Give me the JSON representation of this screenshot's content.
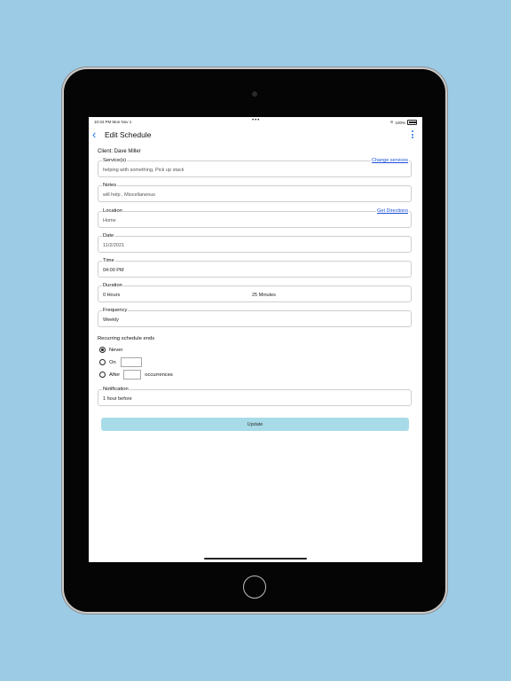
{
  "status_bar": {
    "time": "10:34 PM   Mon Nov 1",
    "battery": "100%"
  },
  "nav": {
    "back_icon": "chevron-left-icon",
    "title": "Edit Schedule",
    "menu_icon": "more-vertical-icon"
  },
  "client": "Client: Dave Miller",
  "fields": {
    "services": {
      "label": "Service(s)",
      "value": "helping with something, Pick up stack",
      "link": "Change services"
    },
    "notes": {
      "label": "Notes",
      "value": "will help , Miscellaneous"
    },
    "location": {
      "label": "Location",
      "value": "Home",
      "link": "Get Directions"
    },
    "date": {
      "label": "Date",
      "value": "11/2/2021"
    },
    "time": {
      "label": "Time",
      "value": "04:00 PM"
    },
    "duration": {
      "label": "Duration",
      "hours": "0 Hours",
      "minutes": "25 Minutes"
    },
    "frequency": {
      "label": "Frequency",
      "value": "Weekly"
    },
    "notification": {
      "label": "Notification",
      "value": "1 hour before"
    }
  },
  "recurring": {
    "label": "Recurring schedule ends",
    "never": "Never",
    "on": "On",
    "after": "After",
    "occurrences": "occurrences",
    "selected": "never"
  },
  "update_button": "Update",
  "colors": {
    "background": "#9ccbe6",
    "accent": "#1a73e8",
    "button": "#a8dbe8",
    "link": "#1a4fd8"
  }
}
